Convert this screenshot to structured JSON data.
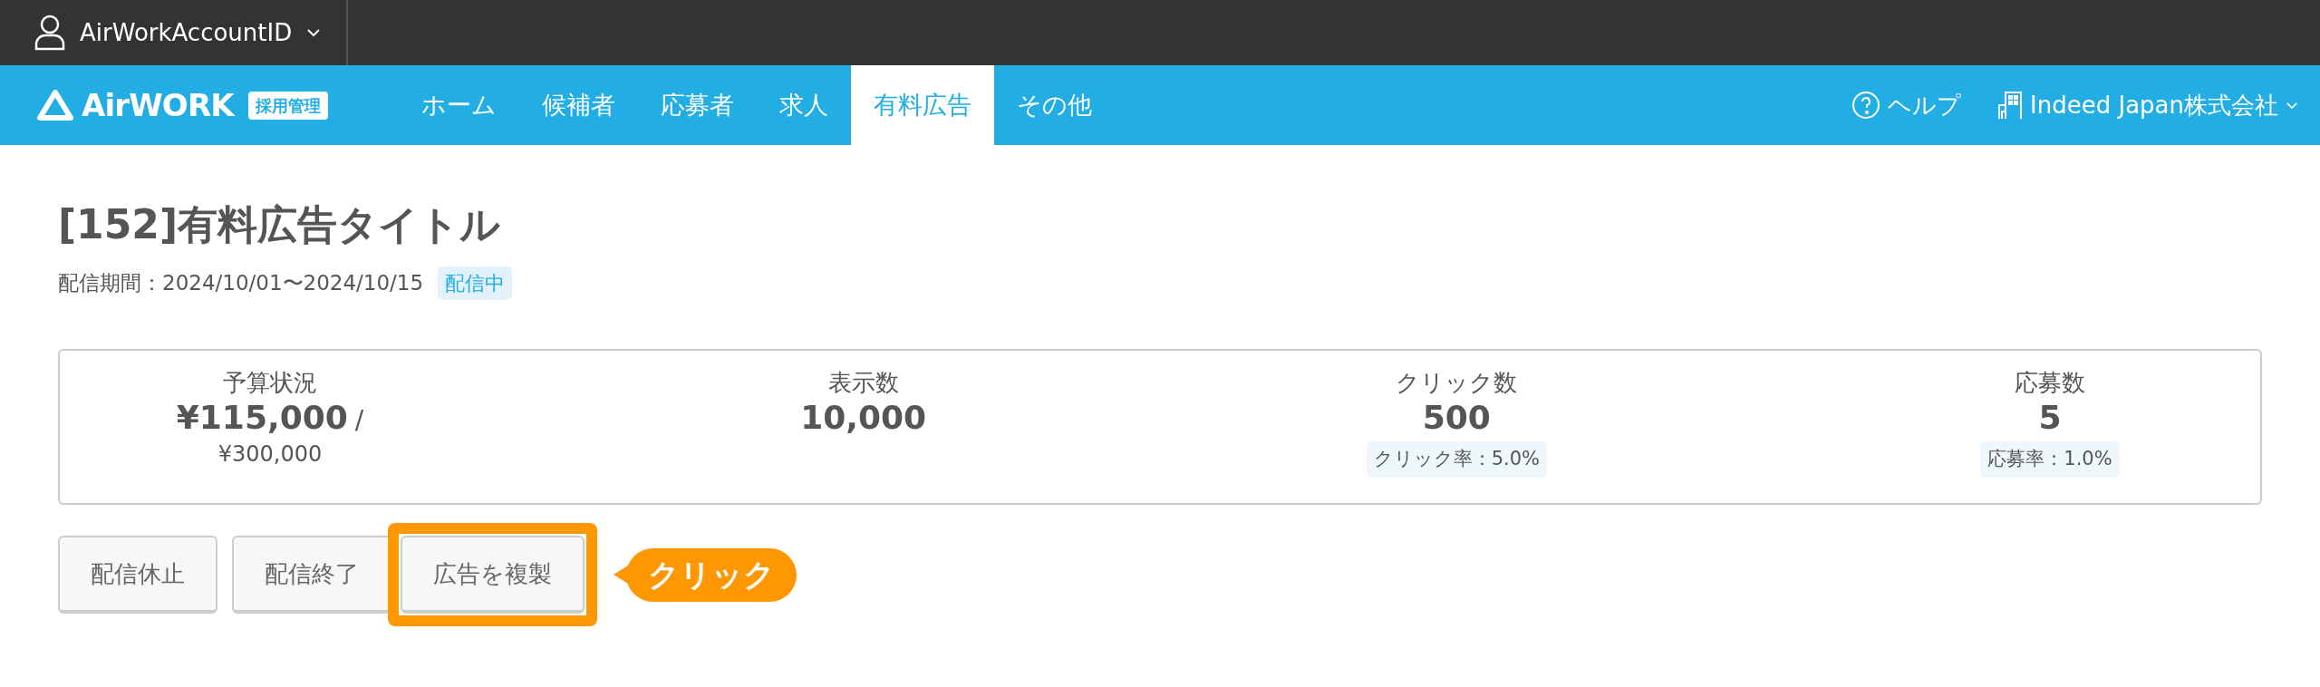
{
  "account": {
    "label": "AirWorkAccountID"
  },
  "logo": {
    "name": "AirWORK",
    "badge": "採用管理"
  },
  "nav": [
    {
      "label": "ホーム",
      "selected": false
    },
    {
      "label": "候補者",
      "selected": false
    },
    {
      "label": "応募者",
      "selected": false
    },
    {
      "label": "求人",
      "selected": false
    },
    {
      "label": "有料広告",
      "selected": true
    },
    {
      "label": "その他",
      "selected": false
    }
  ],
  "help": "ヘルプ",
  "company": "Indeed Japan株式会社",
  "title": "[152]有料広告タイトル",
  "period": "配信期間：2024/10/01〜2024/10/15",
  "status": "配信中",
  "stats": [
    {
      "label": "予算状況",
      "value": "¥115,000",
      "separator": "/",
      "total": "¥300,000"
    },
    {
      "label": "表示数",
      "value": "10,000"
    },
    {
      "label": "クリック数",
      "value": "500",
      "rate": "クリック率：5.0%"
    },
    {
      "label": "応募数",
      "value": "5",
      "rate": "応募率：1.0%"
    }
  ],
  "buttons": [
    {
      "label": "配信休止",
      "highlighted": false
    },
    {
      "label": "配信終了",
      "highlighted": false
    },
    {
      "label": "広告を複製",
      "highlighted": true
    }
  ],
  "callout": "クリック"
}
